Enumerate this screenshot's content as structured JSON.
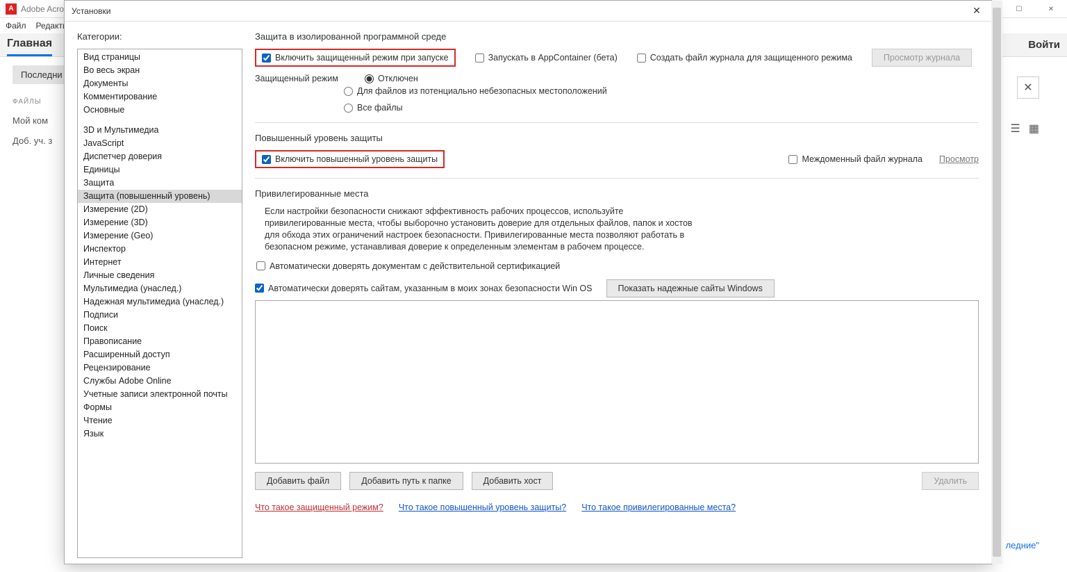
{
  "app": {
    "title": "Adobe Acro",
    "menu": {
      "file": "Файл",
      "edit": "Редакти"
    },
    "tabs": {
      "home": "Главная",
      "login": "Войти"
    },
    "side": {
      "recent_btn": "Последни",
      "files_heading": "ФАЙЛЫ",
      "my_comp": "Мой ком",
      "add_account": "Доб. уч. з"
    },
    "recent_tag": "ледние\""
  },
  "dialog": {
    "title": "Установки",
    "cat_label": "Категории:",
    "categories_group1": [
      "Вид страницы",
      "Во весь экран",
      "Документы",
      "Комментирование",
      "Основные"
    ],
    "categories_group2": [
      "3D и Мультимедиа",
      "JavaScript",
      "Диспетчер доверия",
      "Единицы",
      "Защита",
      "Защита (повышенный уровень)",
      "Измерение (2D)",
      "Измерение (3D)",
      "Измерение (Geo)",
      "Инспектор",
      "Интернет",
      "Личные сведения",
      "Мультимедиа (унаслед.)",
      "Надежная мультимедиа (унаслед.)",
      "Подписи",
      "Поиск",
      "Правописание",
      "Расширенный доступ",
      "Рецензирование",
      "Службы Adobe Online",
      "Учетные записи электронной почты",
      "Формы",
      "Чтение",
      "Язык"
    ],
    "selected_category": "Защита (повышенный уровень)"
  },
  "sec1": {
    "title": "Защита в изолированной программной среде",
    "chk_protected": "Включить защищенный режим при запуске",
    "chk_appcontainer": "Запускать в AppContainer (бета)",
    "chk_logfile": "Создать файл журнала для защищенного режима",
    "btn_viewlog": "Просмотр журнала",
    "mode_label": "Защищенный режим",
    "radio_off": "Отключен",
    "radio_unsafe": "Для файлов из потенциально небезопасных местоположений",
    "radio_all": "Все файлы"
  },
  "sec2": {
    "title": "Повышенный уровень защиты",
    "chk_enhanced": "Включить повышенный уровень защиты",
    "chk_crosslog": "Междоменный файл журнала",
    "link_view": "Просмотр"
  },
  "sec3": {
    "title": "Привилегированные места",
    "para": "Если настройки безопасности снижают эффективность рабочих процессов, используйте привилегированные места, чтобы выборочно установить доверие для отдельных файлов, папок и хостов для обхода этих ограничений настроек безопасности. Привилегированные места позволяют работать в безопасном режиме, устанавливая доверие к определенным элементам в рабочем процессе.",
    "chk_trust_cert": "Автоматически доверять документам с действительной сертификацией",
    "chk_trust_sites": "Автоматически доверять сайтам, указанным в моих зонах безопасности Win OS",
    "btn_show_trusted": "Показать надежные сайты Windows",
    "btn_add_file": "Добавить файл",
    "btn_add_folder": "Добавить путь к папке",
    "btn_add_host": "Добавить хост",
    "btn_delete": "Удалить"
  },
  "footer": {
    "link1": "Что такое защищенный режим?",
    "link2": "Что такое повышенный уровень защиты?",
    "link3": "Что такое привилегированные места?"
  }
}
